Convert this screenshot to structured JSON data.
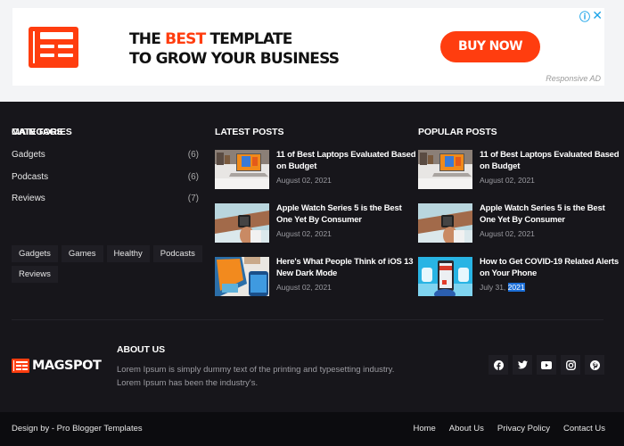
{
  "ad": {
    "headline_part1": "THE ",
    "headline_highlight": "BEST",
    "headline_part2": " TEMPLATE",
    "headline_line2": "TO GROW YOUR BUSINESS",
    "cta_label": "BUY NOW",
    "info_icon": "info-icon",
    "close_icon": "close-icon",
    "close_glyph": "✕",
    "info_glyph": "ⓘ",
    "note": "Responsive AD",
    "accent_color": "#ff3d0f"
  },
  "categories": {
    "title": "CATEGORIES",
    "items": [
      {
        "label": "Gadgets",
        "count": "(6)"
      },
      {
        "label": "Podcasts",
        "count": "(6)"
      },
      {
        "label": "Reviews",
        "count": "(7)"
      }
    ]
  },
  "main_tags": {
    "title": "MAIN TAGS",
    "items": [
      "Gadgets",
      "Games",
      "Healthy",
      "Podcasts",
      "Reviews"
    ]
  },
  "latest_posts": {
    "title": "LATEST POSTS",
    "items": [
      {
        "title": "11 of Best Laptops Evaluated Based on Budget",
        "date": "August 02, 2021",
        "thumb": "laptop"
      },
      {
        "title": "Apple Watch Series 5 is the Best One Yet By Consumer",
        "date": "August 02, 2021",
        "thumb": "watch"
      },
      {
        "title": "Here's What People Think of iOS 13 New Dark Mode",
        "date": "August 02, 2021",
        "thumb": "ios"
      }
    ]
  },
  "popular_posts": {
    "title": "POPULAR POSTS",
    "items": [
      {
        "title": "11 of Best Laptops Evaluated Based on Budget",
        "date": "August 02, 2021",
        "thumb": "laptop"
      },
      {
        "title": "Apple Watch Series 5 is the Best One Yet By Consumer",
        "date": "August 02, 2021",
        "thumb": "watch"
      },
      {
        "title": "How to Get COVID-19 Related Alerts on Your Phone",
        "date_prefix": "July 31, ",
        "date_selected": "2021",
        "thumb": "phone"
      }
    ]
  },
  "brand": {
    "name": "MAGSPOT",
    "color": "#ff3d0f"
  },
  "about": {
    "title": "ABOUT US",
    "text": "Lorem Ipsum is simply dummy text of the printing and typesetting industry. Lorem Ipsum has been the industry's."
  },
  "social": [
    "facebook-icon",
    "twitter-icon",
    "youtube-icon",
    "instagram-icon",
    "pinterest-icon"
  ],
  "bottom": {
    "credit": "Design by - Pro Blogger Templates",
    "links": [
      "Home",
      "About Us",
      "Privacy Policy",
      "Contact Us"
    ]
  }
}
